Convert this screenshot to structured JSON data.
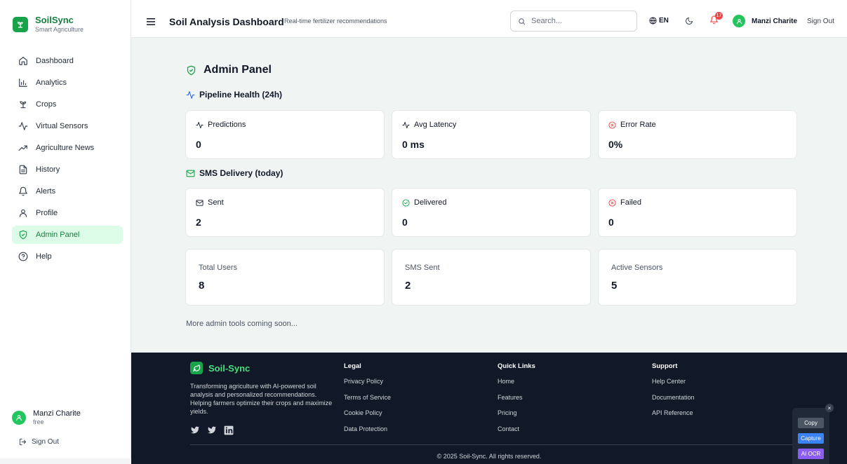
{
  "brand": {
    "name": "SoilSync",
    "tagline": "Smart Agriculture"
  },
  "sidebar": {
    "items": [
      {
        "label": "Dashboard",
        "icon": "home-icon"
      },
      {
        "label": "Analytics",
        "icon": "bar-chart-icon"
      },
      {
        "label": "Crops",
        "icon": "sprout-icon"
      },
      {
        "label": "Virtual Sensors",
        "icon": "activity-icon"
      },
      {
        "label": "Agriculture News",
        "icon": "trending-up-icon"
      },
      {
        "label": "History",
        "icon": "file-text-icon"
      },
      {
        "label": "Alerts",
        "icon": "bell-icon"
      },
      {
        "label": "Profile",
        "icon": "user-icon"
      },
      {
        "label": "Admin Panel",
        "icon": "shield-check-icon",
        "active": true
      },
      {
        "label": "Help",
        "icon": "help-circle-icon"
      }
    ],
    "user": {
      "name": "Manzi Charite",
      "plan": "free"
    },
    "sign_out": "Sign Out"
  },
  "header": {
    "title": "Soil Analysis Dashboard",
    "subtitle": "Real-time fertilizer recommendations",
    "search_placeholder": "Search...",
    "language": "EN",
    "notification_count": "17",
    "user_name": "Manzi Charite",
    "sign_out": "Sign Out"
  },
  "main": {
    "title": "Admin Panel",
    "pipeline": {
      "title": "Pipeline Health (24h)",
      "cards": [
        {
          "label": "Predictions",
          "value": "0",
          "icon": "activity-icon"
        },
        {
          "label": "Avg Latency",
          "value": "0 ms",
          "icon": "activity-icon"
        },
        {
          "label": "Error Rate",
          "value": "0%",
          "icon": "x-circle-icon"
        }
      ]
    },
    "sms": {
      "title": "SMS Delivery (today)",
      "cards": [
        {
          "label": "Sent",
          "value": "2",
          "icon": "mail-icon"
        },
        {
          "label": "Delivered",
          "value": "0",
          "icon": "check-circle-icon"
        },
        {
          "label": "Failed",
          "value": "0",
          "icon": "x-circle-icon"
        }
      ]
    },
    "stats": [
      {
        "label": "Total Users",
        "value": "8"
      },
      {
        "label": "SMS Sent",
        "value": "2"
      },
      {
        "label": "Active Sensors",
        "value": "5"
      }
    ],
    "more_tools": "More admin tools coming soon..."
  },
  "footer": {
    "brand": "Soil-Sync",
    "description": "Transforming agriculture with AI-powered soil analysis and personalized recommendations. Helping farmers optimize their crops and maximize yields.",
    "columns": [
      {
        "title": "Legal",
        "links": [
          "Privacy Policy",
          "Terms of Service",
          "Cookie Policy",
          "Data Protection"
        ]
      },
      {
        "title": "Quick Links",
        "links": [
          "Home",
          "Features",
          "Pricing",
          "Contact"
        ]
      },
      {
        "title": "Support",
        "links": [
          "Help Center",
          "Documentation",
          "API Reference"
        ]
      }
    ],
    "copyright": "© 2025 Soil-Sync. All rights reserved."
  },
  "widget": {
    "copy": "Copy",
    "capture": "Capture",
    "ocr": "AI OCR",
    "close": "×"
  },
  "colors": {
    "brand_green": "#16a34a",
    "active_bg": "#dcfce7",
    "footer_bg": "#111827",
    "error_red": "#ef4444",
    "info_blue": "#2563eb"
  }
}
